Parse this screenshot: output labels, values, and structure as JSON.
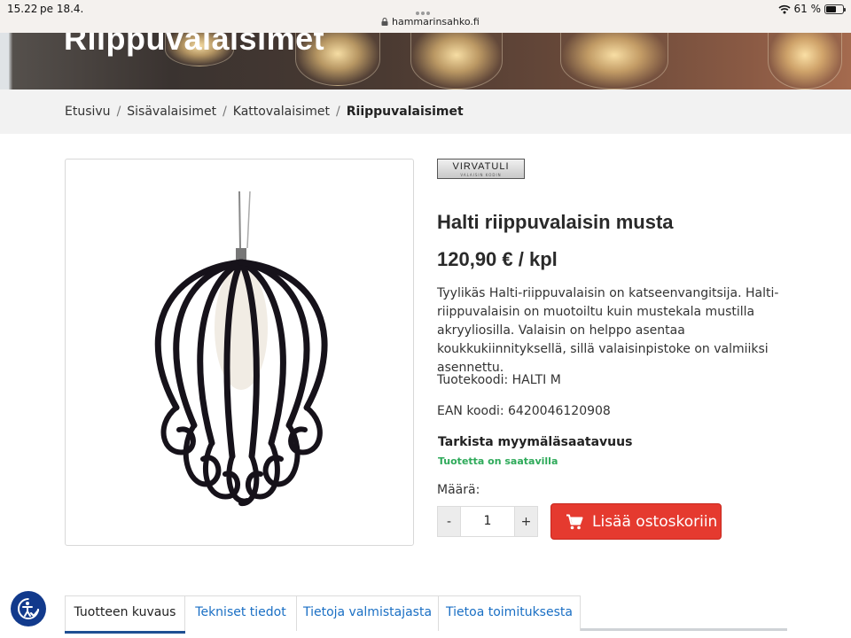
{
  "status_bar": {
    "time": "15.22",
    "date": "pe 18.4.",
    "url": "hammarinsahko.fi",
    "battery": "61 %",
    "battery_level": 0.61
  },
  "hero": {
    "title": "Riippuvalaisimet"
  },
  "breadcrumb": {
    "items": [
      "Etusivu",
      "Sisävalaisimet",
      "Kattovalaisimet"
    ],
    "current": "Riippuvalaisimet",
    "separator": "/"
  },
  "product": {
    "brand": "VIRVATULI",
    "brand_sub": "VALAISIN KODIN",
    "title": "Halti riippuvalaisin musta",
    "price": "120,90 € / kpl",
    "description": "Tyylikäs Halti-riippuvalaisin on katseenvangitsija. Halti-riippuvalaisin on muotoiltu kuin mustekala mustilla akryyliosilla. Valaisin on helppo asentaa koukkukiinnityksellä, sillä valaisinpistoke on valmiiksi asennettu.",
    "product_code": "Tuotekoodi: HALTI M",
    "ean_code": "EAN koodi: 6420046120908",
    "check_store": "Tarkista myymäläsaatavuus",
    "availability": "Tuotetta on saatavilla",
    "quantity_label": "Määrä:",
    "quantity_minus": "-",
    "quantity_value": "1",
    "quantity_plus": "+",
    "add_to_cart": "Lisää ostoskoriin"
  },
  "tabs": [
    {
      "label": "Tuotteen kuvaus",
      "active": true
    },
    {
      "label": "Tekniset tiedot",
      "active": false
    },
    {
      "label": "Tietoja valmistajasta",
      "active": false
    },
    {
      "label": "Tietoa toimituksesta",
      "active": false
    }
  ],
  "colors": {
    "accent_red": "#e53a2f",
    "availability_green": "#2eaa5a",
    "link_blue": "#1a6fc4",
    "a11y_blue": "#123a8c"
  }
}
